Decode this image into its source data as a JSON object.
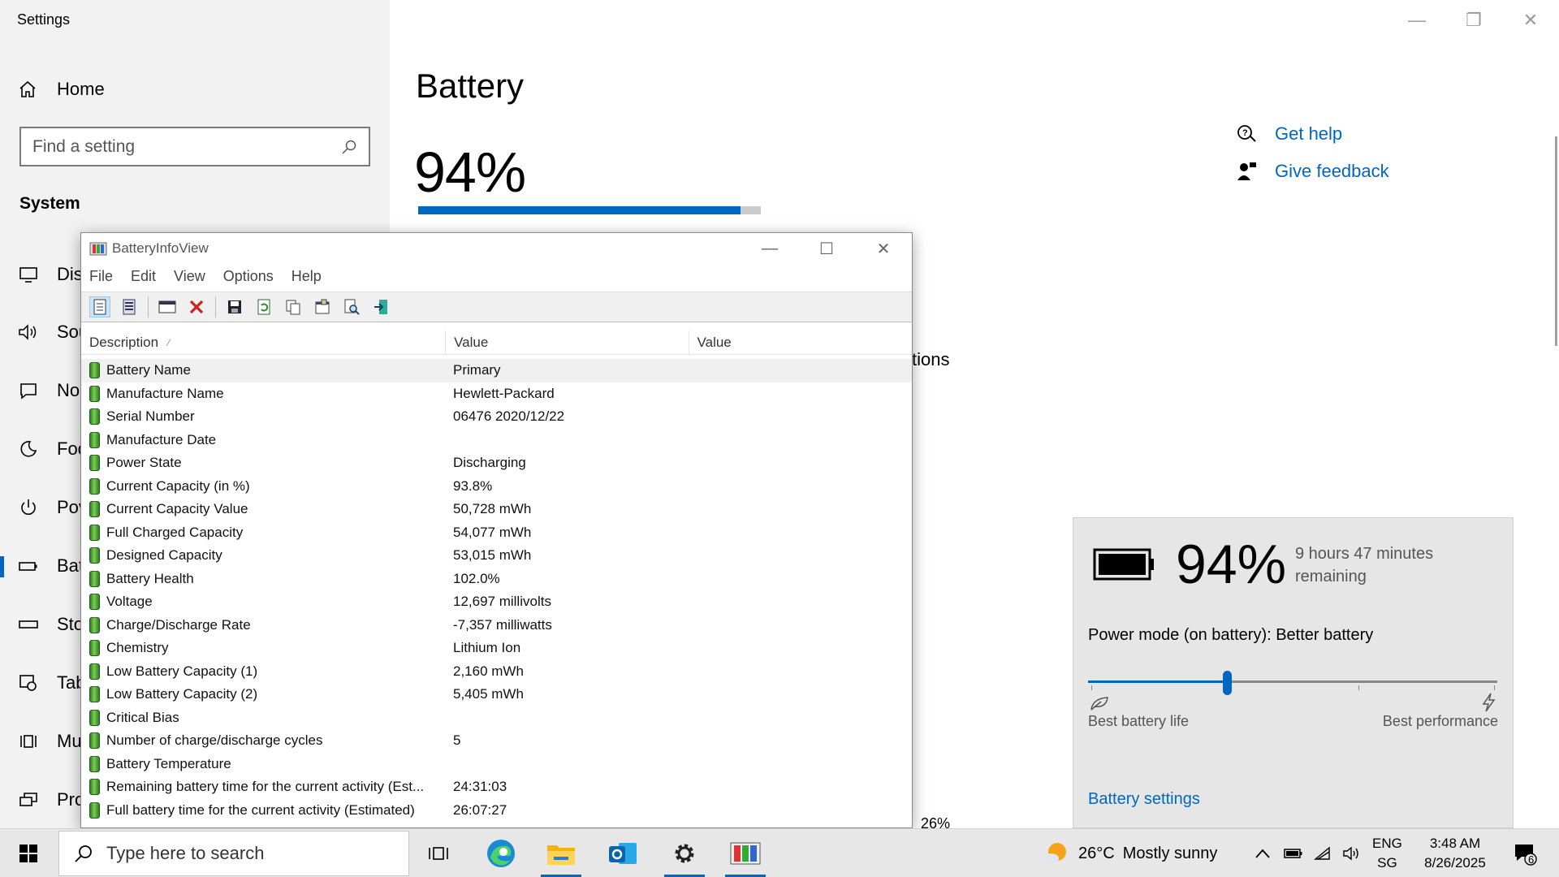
{
  "settings": {
    "app_title": "Settings",
    "home_label": "Home",
    "search_placeholder": "Find a setting",
    "section_label": "System",
    "nav_items": [
      {
        "label": "Dis",
        "icon": "display-icon"
      },
      {
        "label": "Sou",
        "icon": "sound-icon"
      },
      {
        "label": "No",
        "icon": "notifications-icon"
      },
      {
        "label": "Foc",
        "icon": "focus-assist-icon"
      },
      {
        "label": "Pov",
        "icon": "power-icon"
      },
      {
        "label": "Bat",
        "icon": "battery-icon"
      },
      {
        "label": "Sto",
        "icon": "storage-icon"
      },
      {
        "label": "Tab",
        "icon": "tablet-icon"
      },
      {
        "label": "Mu",
        "icon": "multitasking-icon"
      },
      {
        "label": "Pro",
        "icon": "projecting-icon"
      }
    ],
    "page_title": "Battery",
    "battery_percent_text": "94%",
    "battery_level": 0.94,
    "hidden_fragment": "tions",
    "hidden_fragment2": "26%",
    "get_help": "Get help",
    "give_feedback": "Give feedback"
  },
  "batteryinfoview": {
    "title": "BatteryInfoView",
    "menu": [
      "File",
      "Edit",
      "View",
      "Options",
      "Help"
    ],
    "columns": [
      "Description",
      "Value",
      "Value"
    ],
    "rows": [
      {
        "desc": "Battery Name",
        "value": "Primary"
      },
      {
        "desc": "Manufacture Name",
        "value": "Hewlett-Packard"
      },
      {
        "desc": "Serial Number",
        "value": "06476 2020/12/22"
      },
      {
        "desc": "Manufacture Date",
        "value": ""
      },
      {
        "desc": "Power State",
        "value": "Discharging"
      },
      {
        "desc": "Current Capacity (in %)",
        "value": "93.8%"
      },
      {
        "desc": "Current Capacity Value",
        "value": "50,728 mWh"
      },
      {
        "desc": "Full Charged Capacity",
        "value": "54,077 mWh"
      },
      {
        "desc": "Designed Capacity",
        "value": "53,015 mWh"
      },
      {
        "desc": "Battery Health",
        "value": "102.0%"
      },
      {
        "desc": "Voltage",
        "value": "12,697 millivolts"
      },
      {
        "desc": "Charge/Discharge Rate",
        "value": "-7,357 milliwatts"
      },
      {
        "desc": "Chemistry",
        "value": "Lithium Ion"
      },
      {
        "desc": "Low Battery Capacity (1)",
        "value": "2,160 mWh"
      },
      {
        "desc": "Low Battery Capacity (2)",
        "value": "5,405 mWh"
      },
      {
        "desc": "Critical Bias",
        "value": ""
      },
      {
        "desc": "Number of charge/discharge cycles",
        "value": "5"
      },
      {
        "desc": "Battery Temperature",
        "value": ""
      },
      {
        "desc": "Remaining battery time for the current activity (Est...",
        "value": "24:31:03"
      },
      {
        "desc": "Full battery time for the current activity (Estimated)",
        "value": "26:07:27"
      }
    ]
  },
  "flyout": {
    "percent": "94%",
    "remaining": "9 hours 47 minutes remaining",
    "power_mode": "Power mode (on battery): Better battery",
    "slider_level": 0.34,
    "best_life": "Best battery life",
    "best_performance": "Best performance",
    "settings_link": "Battery settings"
  },
  "taskbar": {
    "search_placeholder": "Type here to search",
    "weather_temp": "26°C",
    "weather_text": "Mostly sunny",
    "lang_line1": "ENG",
    "lang_line2": "SG",
    "time": "3:48 AM",
    "date": "8/26/2025",
    "notification_count": "6"
  },
  "colors": {
    "accent": "#0067c0",
    "battery_green": "#4caf2a"
  }
}
